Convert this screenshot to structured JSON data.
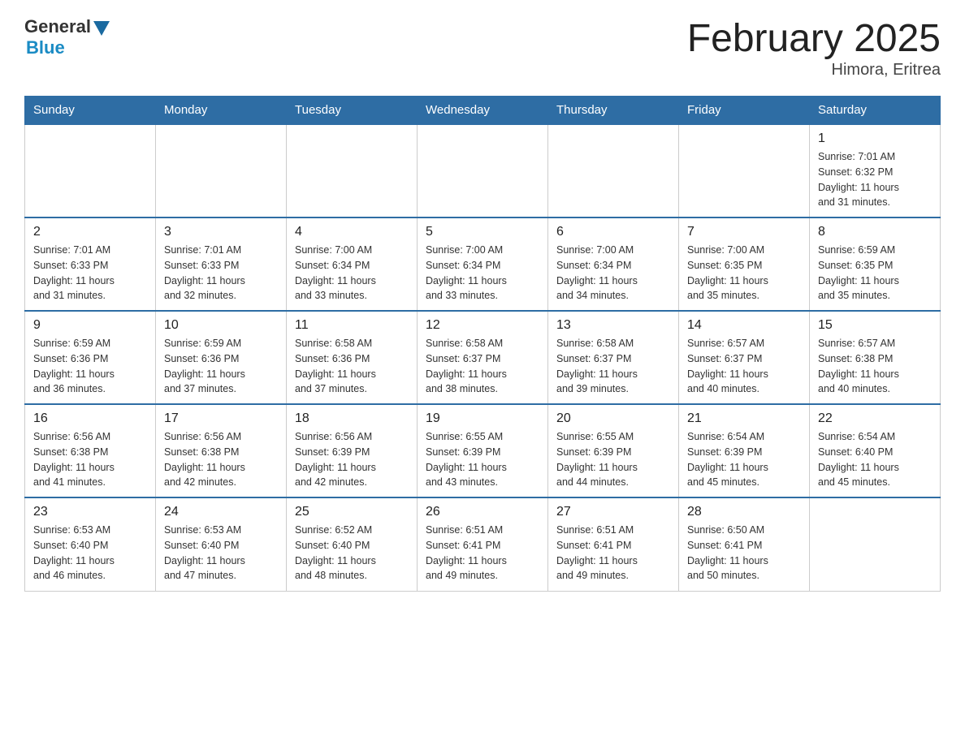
{
  "header": {
    "logo_general": "General",
    "logo_blue": "Blue",
    "month_title": "February 2025",
    "location": "Himora, Eritrea"
  },
  "weekdays": [
    "Sunday",
    "Monday",
    "Tuesday",
    "Wednesday",
    "Thursday",
    "Friday",
    "Saturday"
  ],
  "weeks": [
    [
      {
        "day": "",
        "info": ""
      },
      {
        "day": "",
        "info": ""
      },
      {
        "day": "",
        "info": ""
      },
      {
        "day": "",
        "info": ""
      },
      {
        "day": "",
        "info": ""
      },
      {
        "day": "",
        "info": ""
      },
      {
        "day": "1",
        "info": "Sunrise: 7:01 AM\nSunset: 6:32 PM\nDaylight: 11 hours\nand 31 minutes."
      }
    ],
    [
      {
        "day": "2",
        "info": "Sunrise: 7:01 AM\nSunset: 6:33 PM\nDaylight: 11 hours\nand 31 minutes."
      },
      {
        "day": "3",
        "info": "Sunrise: 7:01 AM\nSunset: 6:33 PM\nDaylight: 11 hours\nand 32 minutes."
      },
      {
        "day": "4",
        "info": "Sunrise: 7:00 AM\nSunset: 6:34 PM\nDaylight: 11 hours\nand 33 minutes."
      },
      {
        "day": "5",
        "info": "Sunrise: 7:00 AM\nSunset: 6:34 PM\nDaylight: 11 hours\nand 33 minutes."
      },
      {
        "day": "6",
        "info": "Sunrise: 7:00 AM\nSunset: 6:34 PM\nDaylight: 11 hours\nand 34 minutes."
      },
      {
        "day": "7",
        "info": "Sunrise: 7:00 AM\nSunset: 6:35 PM\nDaylight: 11 hours\nand 35 minutes."
      },
      {
        "day": "8",
        "info": "Sunrise: 6:59 AM\nSunset: 6:35 PM\nDaylight: 11 hours\nand 35 minutes."
      }
    ],
    [
      {
        "day": "9",
        "info": "Sunrise: 6:59 AM\nSunset: 6:36 PM\nDaylight: 11 hours\nand 36 minutes."
      },
      {
        "day": "10",
        "info": "Sunrise: 6:59 AM\nSunset: 6:36 PM\nDaylight: 11 hours\nand 37 minutes."
      },
      {
        "day": "11",
        "info": "Sunrise: 6:58 AM\nSunset: 6:36 PM\nDaylight: 11 hours\nand 37 minutes."
      },
      {
        "day": "12",
        "info": "Sunrise: 6:58 AM\nSunset: 6:37 PM\nDaylight: 11 hours\nand 38 minutes."
      },
      {
        "day": "13",
        "info": "Sunrise: 6:58 AM\nSunset: 6:37 PM\nDaylight: 11 hours\nand 39 minutes."
      },
      {
        "day": "14",
        "info": "Sunrise: 6:57 AM\nSunset: 6:37 PM\nDaylight: 11 hours\nand 40 minutes."
      },
      {
        "day": "15",
        "info": "Sunrise: 6:57 AM\nSunset: 6:38 PM\nDaylight: 11 hours\nand 40 minutes."
      }
    ],
    [
      {
        "day": "16",
        "info": "Sunrise: 6:56 AM\nSunset: 6:38 PM\nDaylight: 11 hours\nand 41 minutes."
      },
      {
        "day": "17",
        "info": "Sunrise: 6:56 AM\nSunset: 6:38 PM\nDaylight: 11 hours\nand 42 minutes."
      },
      {
        "day": "18",
        "info": "Sunrise: 6:56 AM\nSunset: 6:39 PM\nDaylight: 11 hours\nand 42 minutes."
      },
      {
        "day": "19",
        "info": "Sunrise: 6:55 AM\nSunset: 6:39 PM\nDaylight: 11 hours\nand 43 minutes."
      },
      {
        "day": "20",
        "info": "Sunrise: 6:55 AM\nSunset: 6:39 PM\nDaylight: 11 hours\nand 44 minutes."
      },
      {
        "day": "21",
        "info": "Sunrise: 6:54 AM\nSunset: 6:39 PM\nDaylight: 11 hours\nand 45 minutes."
      },
      {
        "day": "22",
        "info": "Sunrise: 6:54 AM\nSunset: 6:40 PM\nDaylight: 11 hours\nand 45 minutes."
      }
    ],
    [
      {
        "day": "23",
        "info": "Sunrise: 6:53 AM\nSunset: 6:40 PM\nDaylight: 11 hours\nand 46 minutes."
      },
      {
        "day": "24",
        "info": "Sunrise: 6:53 AM\nSunset: 6:40 PM\nDaylight: 11 hours\nand 47 minutes."
      },
      {
        "day": "25",
        "info": "Sunrise: 6:52 AM\nSunset: 6:40 PM\nDaylight: 11 hours\nand 48 minutes."
      },
      {
        "day": "26",
        "info": "Sunrise: 6:51 AM\nSunset: 6:41 PM\nDaylight: 11 hours\nand 49 minutes."
      },
      {
        "day": "27",
        "info": "Sunrise: 6:51 AM\nSunset: 6:41 PM\nDaylight: 11 hours\nand 49 minutes."
      },
      {
        "day": "28",
        "info": "Sunrise: 6:50 AM\nSunset: 6:41 PM\nDaylight: 11 hours\nand 50 minutes."
      },
      {
        "day": "",
        "info": ""
      }
    ]
  ]
}
